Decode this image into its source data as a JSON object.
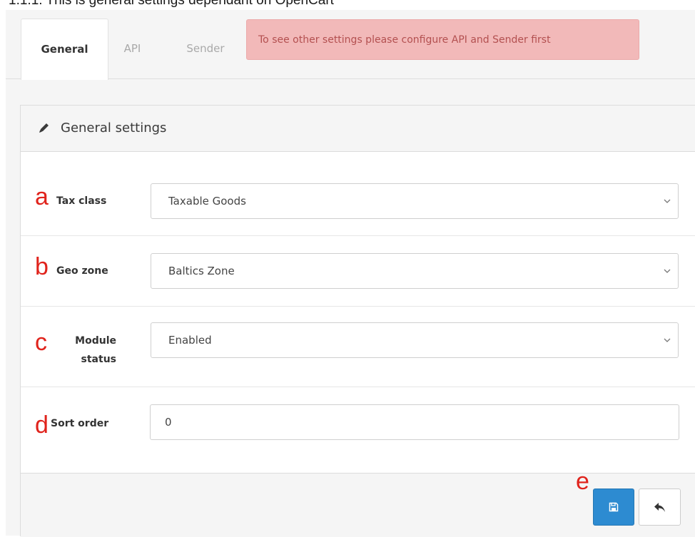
{
  "caption": "1.1.1. This is general settings dependant on OpenCart",
  "tabs": [
    {
      "label": "General",
      "active": true
    },
    {
      "label": "API",
      "active": false
    },
    {
      "label": "Sender",
      "active": false
    }
  ],
  "alert_text": "To see other settings please configure API and Sender first",
  "panel": {
    "title": "General settings",
    "icon": "pencil-icon"
  },
  "fields": {
    "tax_class": {
      "marker": "a",
      "label": "Tax class",
      "value": "Taxable Goods"
    },
    "geo_zone": {
      "marker": "b",
      "label": "Geo zone",
      "value": "Baltics Zone"
    },
    "module_status": {
      "marker": "c",
      "label_line1": "Module",
      "label_line2": "status",
      "value": "Enabled"
    },
    "sort_order": {
      "marker": "d",
      "label": "Sort order",
      "value": "0"
    }
  },
  "footer": {
    "marker": "e",
    "save_icon": "floppy-disk-icon",
    "back_icon": "reply-arrow-icon"
  },
  "colors": {
    "alert_bg": "#f2b9b9",
    "alert_text": "#b35050",
    "primary": "#2d8bd1",
    "marker": "#e0231c"
  }
}
